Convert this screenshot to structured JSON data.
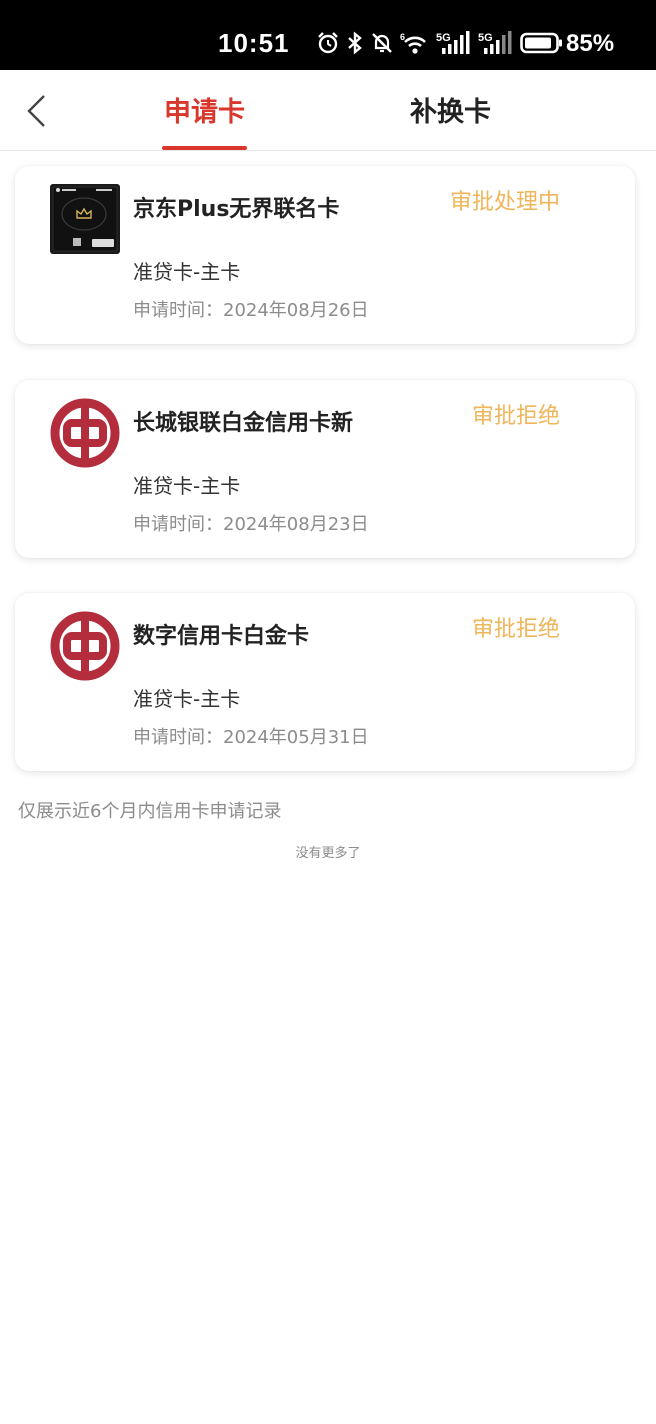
{
  "status_bar": {
    "time": "10:51",
    "battery": "85%",
    "icons": [
      "alarm-icon",
      "bluetooth-icon",
      "mute-icon",
      "wifi-icon",
      "signal-5g-icon",
      "signal-5g-icon",
      "battery-icon"
    ]
  },
  "nav": {
    "tabs": [
      {
        "label": "申请卡",
        "active": true
      },
      {
        "label": "补换卡",
        "active": false
      }
    ]
  },
  "cards": [
    {
      "name": "京东Plus无界联名卡",
      "status": "审批处理中",
      "type": "准贷卡-主卡",
      "date": "申请时间：2024年08月26日",
      "logo": "card-image"
    },
    {
      "name": "长城银联白金信用卡新",
      "status": "审批拒绝",
      "type": "准贷卡-主卡",
      "date": "申请时间：2024年08月23日",
      "logo": "boc-logo"
    },
    {
      "name": "数字信用卡白金卡",
      "status": "审批拒绝",
      "type": "准贷卡-主卡",
      "date": "申请时间：2024年05月31日",
      "logo": "boc-logo"
    }
  ],
  "footer": {
    "note": "仅展示近6个月内信用卡申请记录",
    "no_more": "没有更多了"
  },
  "colors": {
    "accent": "#d9372b",
    "status": "#efb55a",
    "boc_red": "#b32d3d"
  }
}
